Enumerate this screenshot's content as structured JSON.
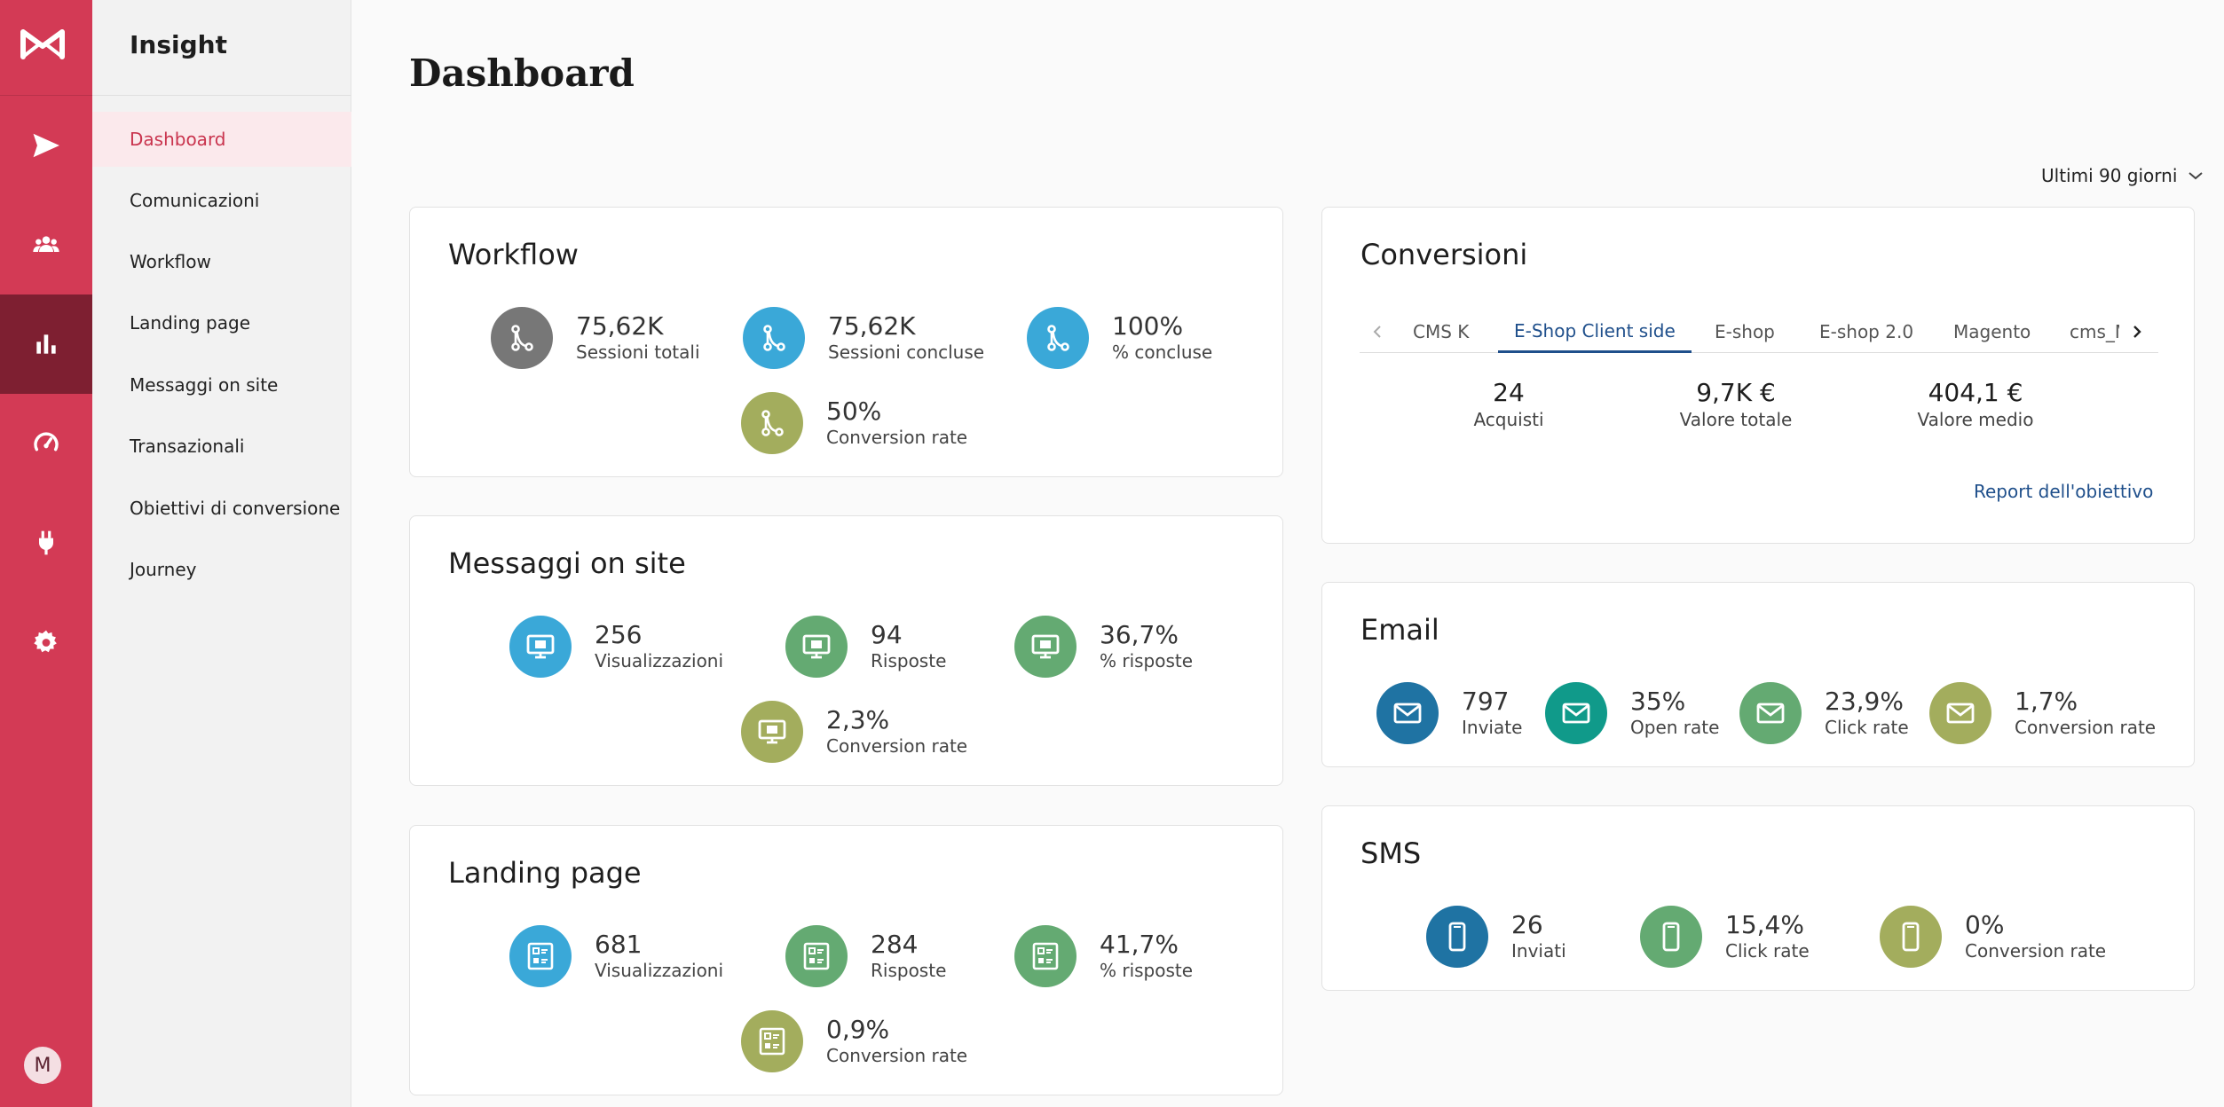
{
  "rail": {
    "avatar_initial": "M",
    "icons": [
      "send-icon",
      "users-icon",
      "bar-chart-icon",
      "gauge-icon",
      "plug-icon",
      "gear-icon"
    ],
    "colors": {
      "rail": "#d33a55",
      "active": "#7e1f31"
    }
  },
  "sidebar": {
    "title": "Insight",
    "items": [
      {
        "label": "Dashboard"
      },
      {
        "label": "Comunicazioni"
      },
      {
        "label": "Workflow"
      },
      {
        "label": "Landing page"
      },
      {
        "label": "Messaggi on site"
      },
      {
        "label": "Transazionali"
      },
      {
        "label": "Obiettivi di conversione"
      },
      {
        "label": "Journey"
      }
    ]
  },
  "main": {
    "title": "Dashboard",
    "range": "Ultimi 90 giorni"
  },
  "workflow": {
    "title": "Workflow",
    "stats": [
      {
        "value": "75,62K",
        "label": "Sessioni totali",
        "color": "#777777",
        "icon": "workflow-icon"
      },
      {
        "value": "75,62K",
        "label": "Sessioni concluse",
        "color": "#3aa8d8",
        "icon": "workflow-icon"
      },
      {
        "value": "100%",
        "label": "% concluse",
        "color": "#3aa8d8",
        "icon": "workflow-icon"
      },
      {
        "value": "50%",
        "label": "Conversion rate",
        "color": "#a3ad5d",
        "icon": "workflow-icon"
      }
    ]
  },
  "messaggi": {
    "title": "Messaggi on site",
    "stats": [
      {
        "value": "256",
        "label": "Visualizzazioni",
        "color": "#3aa8d8",
        "icon": "monitor-icon"
      },
      {
        "value": "94",
        "label": "Risposte",
        "color": "#64aa72",
        "icon": "monitor-icon"
      },
      {
        "value": "36,7%",
        "label": "% risposte",
        "color": "#64aa72",
        "icon": "monitor-icon"
      },
      {
        "value": "2,3%",
        "label": "Conversion rate",
        "color": "#a3ad5d",
        "icon": "monitor-icon"
      }
    ]
  },
  "landing": {
    "title": "Landing page",
    "stats": [
      {
        "value": "681",
        "label": "Visualizzazioni",
        "color": "#3aa8d8",
        "icon": "form-icon"
      },
      {
        "value": "284",
        "label": "Risposte",
        "color": "#64aa72",
        "icon": "form-icon"
      },
      {
        "value": "41,7%",
        "label": "% risposte",
        "color": "#64aa72",
        "icon": "form-icon"
      },
      {
        "value": "0,9%",
        "label": "Conversion rate",
        "color": "#a3ad5d",
        "icon": "form-icon"
      }
    ]
  },
  "conversioni": {
    "title": "Conversioni",
    "tabs": [
      "CMS K",
      "E-Shop Client side",
      "E-shop",
      "E-shop 2.0",
      "Magento",
      "cms_M"
    ],
    "active_tab": "E-Shop Client side",
    "kpis": [
      {
        "value": "24",
        "label": "Acquisti"
      },
      {
        "value": "9,7K €",
        "label": "Valore totale"
      },
      {
        "value": "404,1 €",
        "label": "Valore medio"
      }
    ],
    "report_link": "Report dell'obiettivo"
  },
  "email": {
    "title": "Email",
    "stats": [
      {
        "value": "797",
        "label": "Inviate",
        "color": "#1f73a3",
        "icon": "mail-icon"
      },
      {
        "value": "35%",
        "label": "Open rate",
        "color": "#109a8a",
        "icon": "mail-icon"
      },
      {
        "value": "23,9%",
        "label": "Click rate",
        "color": "#64aa72",
        "icon": "mail-icon"
      },
      {
        "value": "1,7%",
        "label": "Conversion rate",
        "color": "#a3ad5d",
        "icon": "mail-icon"
      }
    ]
  },
  "sms": {
    "title": "SMS",
    "stats": [
      {
        "value": "26",
        "label": "Inviati",
        "color": "#1f73a3",
        "icon": "phone-icon"
      },
      {
        "value": "15,4%",
        "label": "Click rate",
        "color": "#64aa72",
        "icon": "phone-icon"
      },
      {
        "value": "0%",
        "label": "Conversion rate",
        "color": "#a3ad5d",
        "icon": "phone-icon"
      }
    ]
  }
}
